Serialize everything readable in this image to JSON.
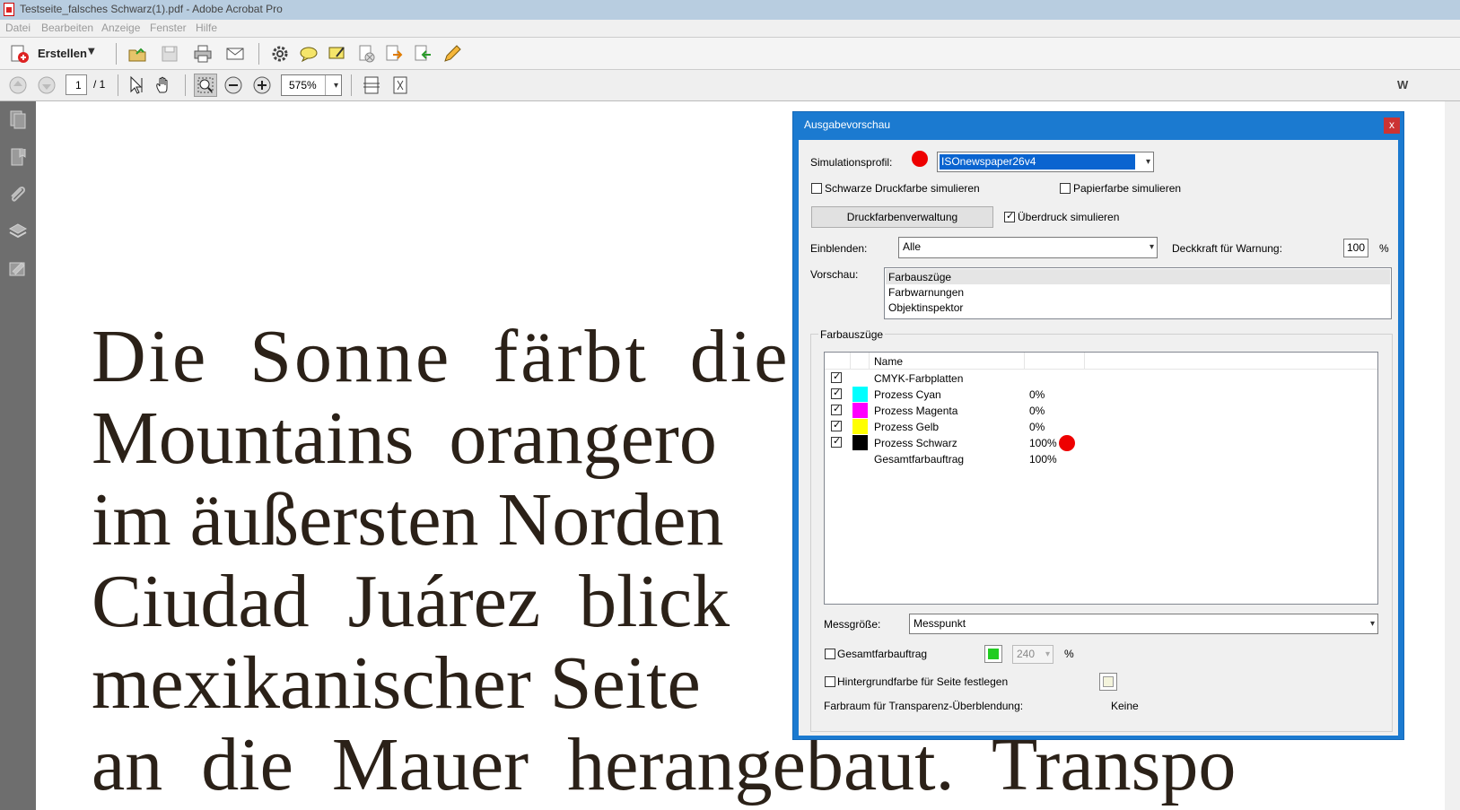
{
  "window": {
    "title": "Testseite_falsches Schwarz(1).pdf - Adobe Acrobat Pro"
  },
  "menu": {
    "items": [
      "Datei",
      "Bearbeiten",
      "Anzeige",
      "Fenster",
      "Hilfe"
    ]
  },
  "toolbar": {
    "create_label": "Erstellen"
  },
  "nav": {
    "page_current": "1",
    "page_total": "/ 1",
    "zoom": "575%"
  },
  "document": {
    "lines": [
      "Die Sonne färbt die",
      "Mountains orangero",
      "im äußersten Norden",
      "Ciudad Juárez blick",
      "mexikanischer Seite",
      "an die Mauer herangebaut. Transpo"
    ]
  },
  "dialog": {
    "title": "Ausgabevorschau",
    "close_label": "x",
    "simulation_profile_label": "Simulationsprofil:",
    "simulation_profile_value": "ISOnewspaper26v4",
    "black_ink_label": "Schwarze Druckfarbe simulieren",
    "paper_color_label": "Papierfarbe simulieren",
    "ink_manager_button": "Druckfarbenverwaltung",
    "overprint_label": "Überdruck simulieren",
    "show_label": "Einblenden:",
    "show_value": "Alle",
    "warning_opacity_label": "Deckkraft für Warnung:",
    "warning_opacity_value": "100",
    "percent": "%",
    "preview_label": "Vorschau:",
    "preview_options": [
      "Farbauszüge",
      "Farbwarnungen",
      "Objektinspektor"
    ],
    "separations_group": "Farbauszüge",
    "table_header_name": "Name",
    "separations": [
      {
        "name": "CMYK-Farbplatten",
        "value": "",
        "checked": true,
        "color": ""
      },
      {
        "name": "Prozess Cyan",
        "value": "0%",
        "checked": true,
        "color": "#00ffff"
      },
      {
        "name": "Prozess Magenta",
        "value": "0%",
        "checked": true,
        "color": "#ff00ff"
      },
      {
        "name": "Prozess Gelb",
        "value": "0%",
        "checked": true,
        "color": "#ffff00"
      },
      {
        "name": "Prozess Schwarz",
        "value": "100%",
        "checked": true,
        "color": "#000000"
      },
      {
        "name": "Gesamtfarbauftrag",
        "value": "100%",
        "checked": false,
        "color": ""
      }
    ],
    "sample_size_label": "Messgröße:",
    "sample_size_value": "Messpunkt",
    "total_coverage_label": "Gesamtfarbauftrag",
    "total_coverage_value": "240",
    "bg_color_label": "Hintergrundfarbe für Seite festlegen",
    "blend_space_label": "Farbraum für Transparenz-Überblendung:",
    "blend_space_value": "Keine"
  },
  "colors": {
    "titlebar": "#b8cde0",
    "dialog_frame": "#1b7ad0",
    "sidebar": "#6e6e6e",
    "marker": "#ee0000",
    "coverage_swatch": "#22cc22"
  }
}
